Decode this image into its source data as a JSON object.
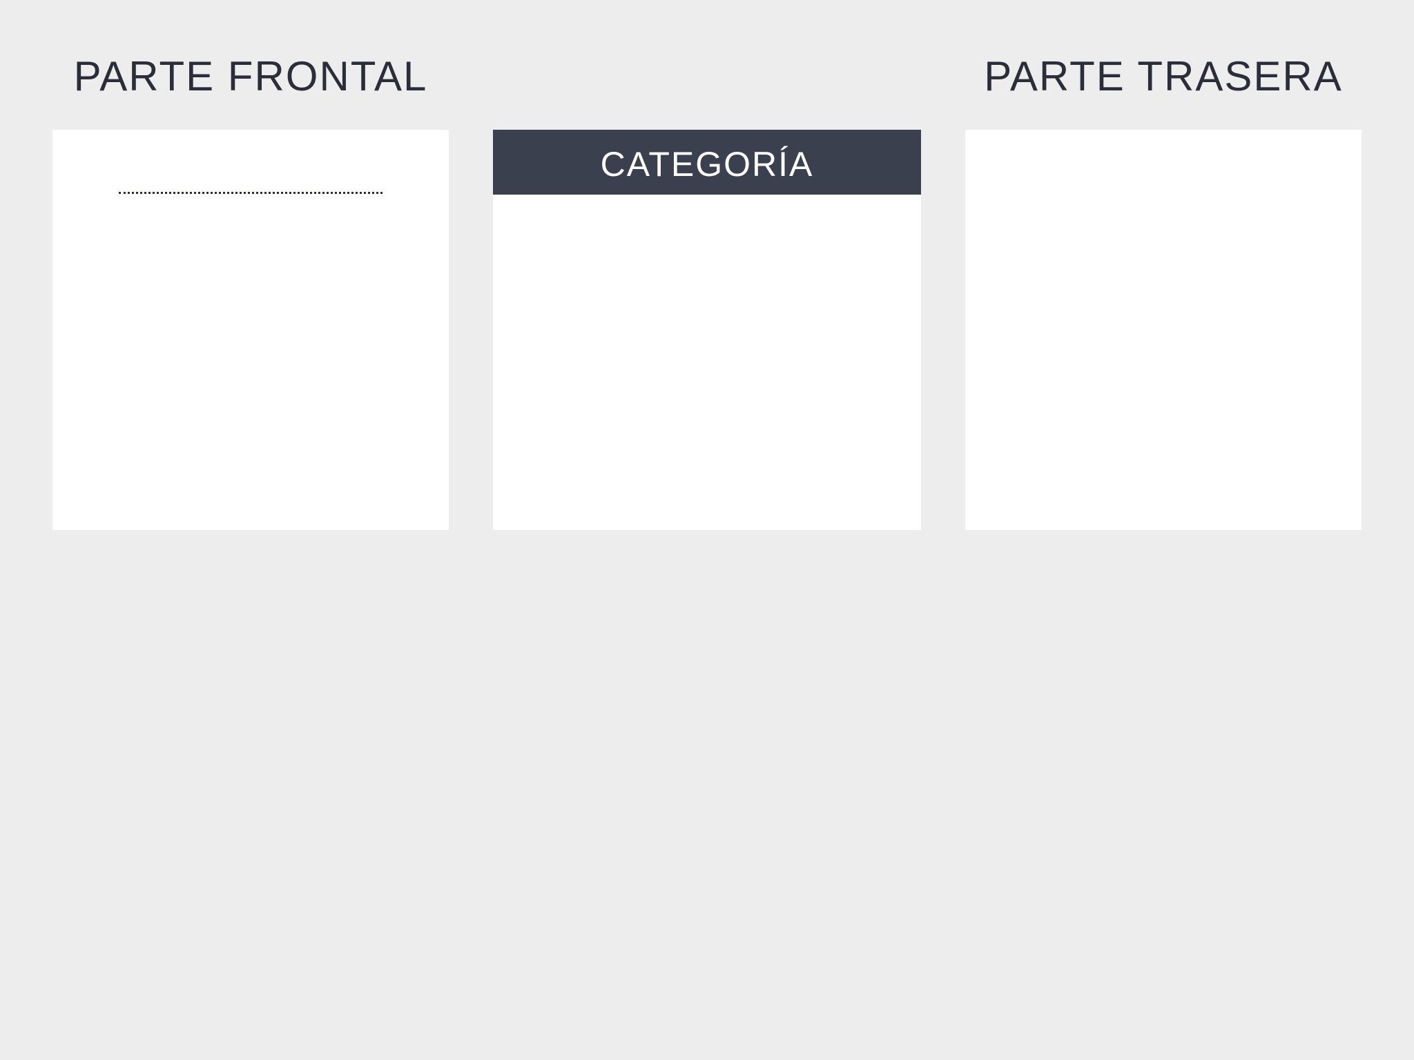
{
  "front": {
    "heading": "PARTE FRONTAL"
  },
  "middle": {
    "header_label": "CATEGORÍA",
    "header_color": "#3b404e"
  },
  "back": {
    "heading": "PARTE TRASERA"
  },
  "colors": {
    "background": "#ededed",
    "card": "#ffffff",
    "heading_text": "#2b2d38"
  }
}
